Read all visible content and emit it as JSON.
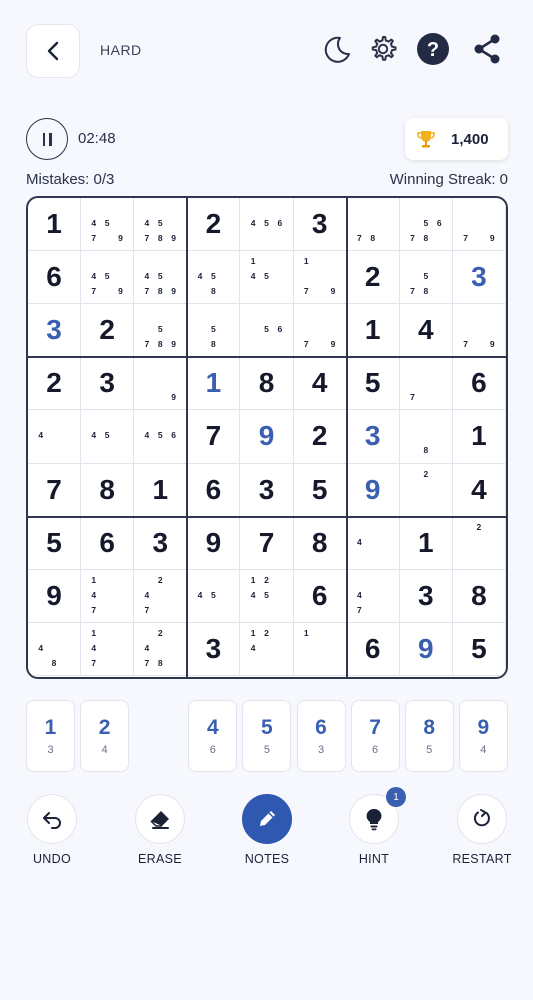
{
  "header": {
    "difficulty": "HARD",
    "icons": [
      "back-arrow-icon",
      "moon-icon",
      "gear-icon",
      "help-icon",
      "share-icon"
    ]
  },
  "status": {
    "timer": "02:48",
    "score": "1,400",
    "mistakes": "Mistakes: 0/3",
    "streak": "Winning Streak: 0"
  },
  "board": {
    "rows": [
      [
        {
          "v": "1",
          "u": false
        },
        {
          "n": [
            4,
            5,
            7,
            9
          ]
        },
        {
          "n": [
            4,
            5,
            7,
            8,
            9
          ]
        },
        {
          "v": "2",
          "u": false
        },
        {
          "n": [
            4,
            5,
            6
          ]
        },
        {
          "v": "3",
          "u": false
        },
        {
          "n": [
            7,
            8
          ]
        },
        {
          "n": [
            5,
            6,
            7,
            8
          ]
        },
        {
          "n": [
            7,
            9
          ]
        }
      ],
      [
        {
          "v": "6",
          "u": false
        },
        {
          "n": [
            4,
            5,
            7,
            9
          ]
        },
        {
          "n": [
            4,
            5,
            7,
            8,
            9
          ]
        },
        {
          "n": [
            4,
            5,
            8
          ]
        },
        {
          "n": [
            1,
            4,
            5
          ]
        },
        {
          "n": [
            1,
            7,
            9
          ]
        },
        {
          "v": "2",
          "u": false
        },
        {
          "n": [
            5,
            7,
            8
          ]
        },
        {
          "v": "3",
          "u": true
        }
      ],
      [
        {
          "v": "3",
          "u": true
        },
        {
          "v": "2",
          "u": false
        },
        {
          "n": [
            5,
            7,
            8,
            9
          ]
        },
        {
          "n": [
            5,
            8
          ]
        },
        {
          "n": [
            5,
            6
          ]
        },
        {
          "n": [
            7,
            9
          ]
        },
        {
          "v": "1",
          "u": false
        },
        {
          "v": "4",
          "u": false
        },
        {
          "n": [
            7,
            9
          ]
        }
      ],
      [
        {
          "v": "2",
          "u": false
        },
        {
          "v": "3",
          "u": false
        },
        {
          "n": [
            9
          ]
        },
        {
          "v": "1",
          "u": true
        },
        {
          "v": "8",
          "u": false
        },
        {
          "v": "4",
          "u": false
        },
        {
          "v": "5",
          "u": false
        },
        {
          "n": [
            7
          ]
        },
        {
          "v": "6",
          "u": false
        }
      ],
      [
        {
          "n": [
            4
          ]
        },
        {
          "n": [
            4,
            5
          ]
        },
        {
          "n": [
            4,
            5,
            6
          ]
        },
        {
          "v": "7",
          "u": false
        },
        {
          "v": "9",
          "u": true
        },
        {
          "v": "2",
          "u": false
        },
        {
          "v": "3",
          "u": true
        },
        {
          "n": [
            8
          ]
        },
        {
          "v": "1",
          "u": false
        }
      ],
      [
        {
          "v": "7",
          "u": false
        },
        {
          "v": "8",
          "u": false
        },
        {
          "v": "1",
          "u": false
        },
        {
          "v": "6",
          "u": false
        },
        {
          "v": "3",
          "u": false
        },
        {
          "v": "5",
          "u": false
        },
        {
          "v": "9",
          "u": true
        },
        {
          "n": [
            2
          ]
        },
        {
          "v": "4",
          "u": false
        }
      ],
      [
        {
          "v": "5",
          "u": false
        },
        {
          "v": "6",
          "u": false
        },
        {
          "v": "3",
          "u": false
        },
        {
          "v": "9",
          "u": false
        },
        {
          "v": "7",
          "u": false
        },
        {
          "v": "8",
          "u": false
        },
        {
          "n": [
            4
          ]
        },
        {
          "v": "1",
          "u": false
        },
        {
          "n": [
            2
          ]
        }
      ],
      [
        {
          "v": "9",
          "u": false
        },
        {
          "n": [
            1,
            4,
            7
          ]
        },
        {
          "n": [
            2,
            4,
            7
          ]
        },
        {
          "n": [
            4,
            5
          ]
        },
        {
          "n": [
            1,
            2,
            4,
            5
          ]
        },
        {
          "v": "6",
          "u": false
        },
        {
          "n": [
            4,
            7
          ]
        },
        {
          "v": "3",
          "u": false
        },
        {
          "v": "8",
          "u": false
        }
      ],
      [
        {
          "n": [
            4,
            8
          ]
        },
        {
          "n": [
            1,
            4,
            7
          ]
        },
        {
          "n": [
            2,
            4,
            7,
            8
          ]
        },
        {
          "v": "3",
          "u": false
        },
        {
          "n": [
            1,
            2,
            4
          ]
        },
        {
          "n": [
            1
          ]
        },
        {
          "v": "6",
          "u": false
        },
        {
          "v": "9",
          "u": true
        },
        {
          "v": "5",
          "u": false
        }
      ]
    ]
  },
  "numpad": [
    {
      "digit": "1",
      "count": "3",
      "slot": 0
    },
    {
      "digit": "2",
      "count": "4",
      "slot": 1
    },
    {
      "digit": "4",
      "count": "6",
      "slot": 3
    },
    {
      "digit": "5",
      "count": "5",
      "slot": 4
    },
    {
      "digit": "6",
      "count": "3",
      "slot": 5
    },
    {
      "digit": "7",
      "count": "6",
      "slot": 6
    },
    {
      "digit": "8",
      "count": "5",
      "slot": 7
    },
    {
      "digit": "9",
      "count": "4",
      "slot": 8
    }
  ],
  "actions": [
    {
      "id": "undo",
      "label": "UNDO",
      "icon": "undo-icon",
      "active": false
    },
    {
      "id": "erase",
      "label": "ERASE",
      "icon": "eraser-icon",
      "active": false
    },
    {
      "id": "notes",
      "label": "NOTES",
      "icon": "pencil-icon",
      "active": true
    },
    {
      "id": "hint",
      "label": "HINT",
      "icon": "lightbulb-icon",
      "active": false,
      "badge": "1"
    },
    {
      "id": "restart",
      "label": "RESTART",
      "icon": "restart-icon",
      "active": false
    }
  ],
  "colors": {
    "accent": "#3a5fb0",
    "dark": "#1b2238",
    "grid_bold": "#2f3650",
    "background": "#f6f8fd"
  }
}
